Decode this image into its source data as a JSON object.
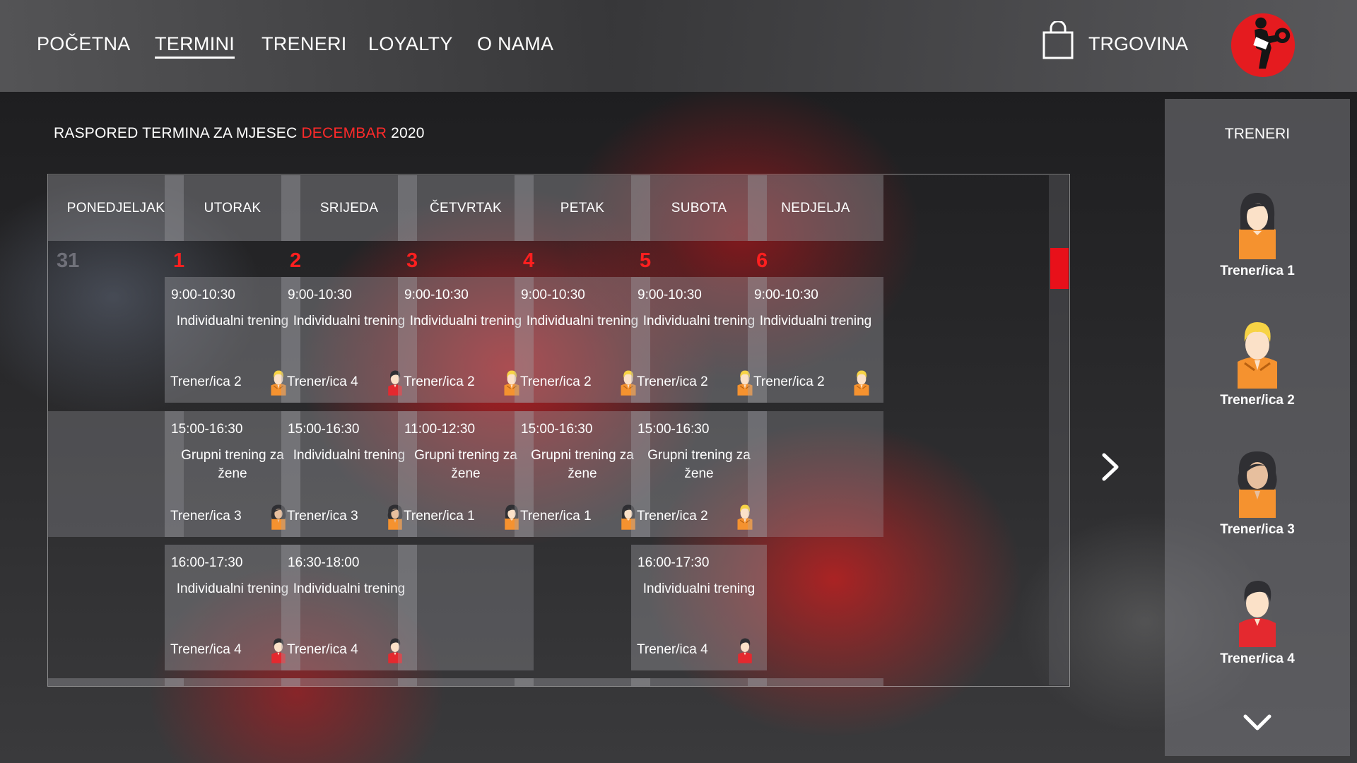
{
  "nav": {
    "items": [
      {
        "label": "POČETNA",
        "active": false
      },
      {
        "label": "TERMINI",
        "active": true
      },
      {
        "label": "TRENERI",
        "active": false
      },
      {
        "label": "LOYALTY",
        "active": false
      },
      {
        "label": "O NAMA",
        "active": false
      }
    ],
    "shop_icon": "shopping-bag-icon",
    "shop_label": "TRGOVINA",
    "logo_icon": "fitness-logo"
  },
  "schedule": {
    "title_prefix": "RASPORED TERMINA ZA MJESEC",
    "month": "DECEMBAR",
    "year": "2020",
    "accent_color": "#ff2a2a",
    "days": [
      "PONEDJELJAK",
      "UTORAK",
      "SRIJEDA",
      "ČETVRTAK",
      "PETAK",
      "SUBOTA",
      "NEDJELJA"
    ],
    "dates": [
      "31",
      "1",
      "2",
      "3",
      "4",
      "5",
      "6"
    ],
    "rows": [
      [
        null,
        {
          "time": "9:00-10:30",
          "name": "Individualni trening",
          "trainer": "Trener/ica 2",
          "avatar": "t2"
        },
        {
          "time": "9:00-10:30",
          "name": "Individualni trening",
          "trainer": "Trener/ica 4",
          "avatar": "t4"
        },
        {
          "time": "9:00-10:30",
          "name": "Individualni trening",
          "trainer": "Trener/ica 2",
          "avatar": "t2"
        },
        {
          "time": "9:00-10:30",
          "name": "Individualni trening",
          "trainer": "Trener/ica 2",
          "avatar": "t2"
        },
        {
          "time": "9:00-10:30",
          "name": "Individualni trening",
          "trainer": "Trener/ica 2",
          "avatar": "t2"
        },
        {
          "time": "9:00-10:30",
          "name": "Individualni trening",
          "trainer": "Trener/ica 2",
          "avatar": "t2"
        }
      ],
      [
        "empty",
        {
          "time": "15:00-16:30",
          "name": "Grupni trening za žene",
          "trainer": "Trener/ica 3",
          "avatar": "t3"
        },
        {
          "time": "15:00-16:30",
          "name": "Individualni trening",
          "trainer": "Trener/ica 3",
          "avatar": "t3"
        },
        {
          "time": "11:00-12:30",
          "name": "Grupni trening za žene",
          "trainer": "Trener/ica 1",
          "avatar": "t1"
        },
        {
          "time": "15:00-16:30",
          "name": "Grupni trening za žene",
          "trainer": "Trener/ica 1",
          "avatar": "t1"
        },
        {
          "time": "15:00-16:30",
          "name": "Grupni trening za žene",
          "trainer": "Trener/ica 2",
          "avatar": "t2"
        },
        "empty"
      ],
      [
        null,
        {
          "time": "16:00-17:30",
          "name": "Individualni trening",
          "trainer": "Trener/ica 4",
          "avatar": "t4"
        },
        {
          "time": "16:30-18:00",
          "name": "Individualni trening",
          "trainer": "Trener/ica 4",
          "avatar": "t4"
        },
        "empty",
        null,
        {
          "time": "16:00-17:30",
          "name": "Individualni trening",
          "trainer": "Trener/ica 4",
          "avatar": "t4"
        },
        null
      ]
    ],
    "next_icon": "chevron-right-icon"
  },
  "sidebar": {
    "title": "TRENERI",
    "trainers": [
      {
        "label": "Trener/ica 1",
        "avatar": "t1"
      },
      {
        "label": "Trener/ica 2",
        "avatar": "t2"
      },
      {
        "label": "Trener/ica 3",
        "avatar": "t3"
      },
      {
        "label": "Trener/ica 4",
        "avatar": "t4"
      }
    ],
    "more_icon": "chevron-down-icon"
  }
}
